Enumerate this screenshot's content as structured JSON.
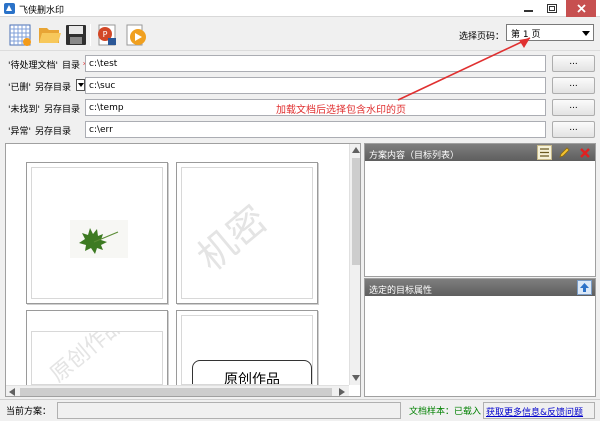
{
  "window": {
    "title": "飞侠删水印",
    "min_icon": "minimize-icon",
    "max_icon": "maximize-icon",
    "close_icon": "close-icon"
  },
  "toolbar": {
    "buttons": [
      {
        "name": "new-scheme-button",
        "icon": "grid-new-icon"
      },
      {
        "name": "open-button",
        "icon": "folder-open-icon"
      },
      {
        "name": "save-button",
        "icon": "floppy-disk-icon"
      },
      {
        "name": "powerpoint-button",
        "icon": "powerpoint-icon"
      },
      {
        "name": "start-button",
        "icon": "play-icon"
      }
    ],
    "page_label": "选择页码：",
    "page_value": "第 1 页"
  },
  "dirs": [
    {
      "label": "'待处理文档'",
      "sub": "目录",
      "required": "*",
      "value": "c:\\test",
      "browse": "...",
      "has_check": false
    },
    {
      "label": "'已删'",
      "sub": "另存目录",
      "required": "",
      "value": "c:\\suc",
      "browse": "...",
      "has_check": true
    },
    {
      "label": "'未找到'",
      "sub": "另存目录",
      "required": "",
      "value": "c:\\temp",
      "browse": "...",
      "has_check": false
    },
    {
      "label": "'异常'",
      "sub": "另存目录",
      "required": "",
      "value": "c:\\err",
      "browse": "...",
      "has_check": false
    }
  ],
  "annotation": {
    "text": "加载文档后选择包含水印的页",
    "color": "#e03030"
  },
  "preview": {
    "watermark_1": "机密",
    "watermark_2": "原创作品",
    "doc_text": "原创作品"
  },
  "scheme_panel": {
    "title": "方案内容（目标列表）",
    "icons": [
      "list-icon",
      "edit-pencil-icon",
      "delete-x-icon"
    ]
  },
  "prop_panel": {
    "title": "选定的目标属性",
    "icon": "upload-arrow-icon"
  },
  "status": {
    "current_label": "当前方案：",
    "current_value": "",
    "sample": "文档样本：已载入",
    "link": "获取更多信息&反馈问题"
  },
  "colors": {
    "accent_red": "#e03030",
    "panel_header": "#6e6e6e",
    "status_green": "#008000",
    "link_blue": "#0000cc"
  }
}
